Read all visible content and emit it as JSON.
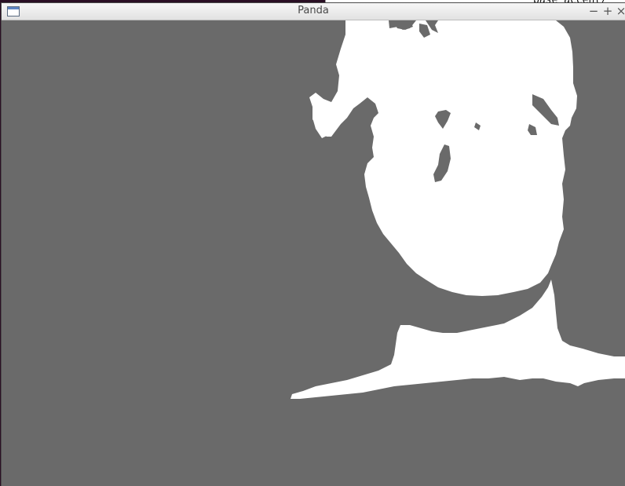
{
  "background_window": {
    "visible_text": "base_accent/ \""
  },
  "window": {
    "title": "Panda",
    "controls": {
      "minimize": "−",
      "maximize": "+",
      "close": "×"
    }
  },
  "scene": {
    "background_color": "#6a6a6a",
    "mask_color": "#ffffff"
  }
}
